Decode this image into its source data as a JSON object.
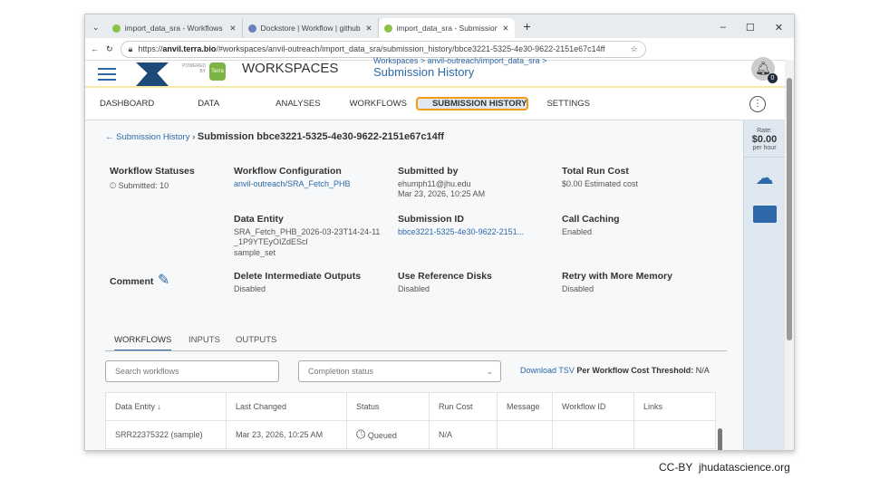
{
  "browser": {
    "tabs": [
      "import_data_sra - Workflows",
      "Dockstore | Workflow | github.com",
      "import_data_sra - Submission Deta"
    ],
    "url_prefix": "https://",
    "url_host": "anvil.terra.bio",
    "url_path": "/#workspaces/anvil-outreach/import_data_sra/submission_history/bbce3221-5325-4e30-9622-2151e67c14ff"
  },
  "header": {
    "powered_by": "POWERED BY",
    "terra": "Terra",
    "title": "WORKSPACES",
    "breadcrumb": "Workspaces > anvil-outreach/import_data_sra >",
    "page": "Submission History",
    "notif_count": "0"
  },
  "nav": [
    "DASHBOARD",
    "DATA",
    "ANALYSES",
    "WORKFLOWS",
    "SUBMISSION HISTORY",
    "SETTINGS"
  ],
  "crumb": {
    "back": "Submission History",
    "current": "Submission bbce3221-5325-4e30-9622-2151e67c14ff"
  },
  "info": {
    "statuses_label": "Workflow Statuses",
    "statuses_val": "Submitted: 10",
    "config_label": "Workflow Configuration",
    "config_val": "anvil-outreach/SRA_Fetch_PHB",
    "by_label": "Submitted by",
    "by_email": "ehumph11@jhu.edu",
    "by_date": "Mar 23, 2026, 10:25 AM",
    "cost_label": "Total Run Cost",
    "cost_val": "$0.00 Estimated cost",
    "entity_label": "Data Entity",
    "entity_val": "SRA_Fetch_PHB_2026-03-23T14-24-11_1P9YTEyOIZdEScl",
    "entity_type": "sample_set",
    "subid_label": "Submission ID",
    "subid_val": "bbce3221-5325-4e30-9622-2151...",
    "caching_label": "Call Caching",
    "caching_val": "Enabled",
    "comment_label": "Comment",
    "delete_label": "Delete Intermediate Outputs",
    "delete_val": "Disabled",
    "refdisk_label": "Use Reference Disks",
    "refdisk_val": "Disabled",
    "retry_label": "Retry with More Memory",
    "retry_val": "Disabled"
  },
  "subtabs": [
    "WORKFLOWS",
    "INPUTS",
    "OUTPUTS"
  ],
  "search_placeholder": "Search workflows",
  "status_filter": "Completion status",
  "download": "Download TSV",
  "threshold_label": "Per Workflow Cost Threshold:",
  "threshold_val": "N/A",
  "table": {
    "headers": [
      "Data Entity",
      "Last Changed",
      "Status",
      "Run Cost",
      "Message",
      "Workflow ID",
      "Links"
    ],
    "rows": [
      [
        "SRR22375322 (sample)",
        "Mar 23, 2026, 10:25 AM",
        "Queued",
        "N/A",
        "",
        "",
        ""
      ]
    ]
  },
  "side": {
    "rate_label": "Rate:",
    "rate": "$0.00",
    "per": "per hour"
  },
  "footer": {
    "license": "CC-BY",
    "site": "jhudatascience.org"
  }
}
